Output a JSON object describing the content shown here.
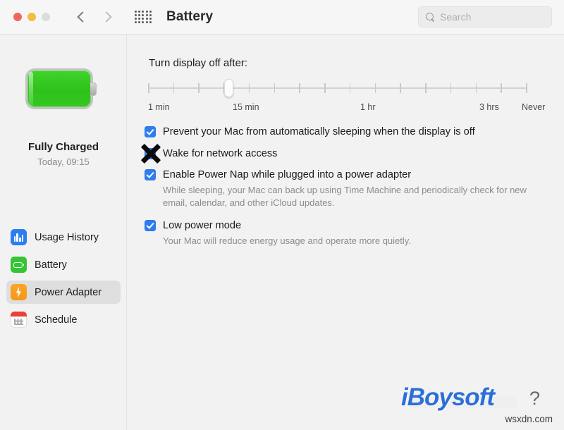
{
  "window": {
    "title": "Battery",
    "traffic_lights": [
      "close",
      "minimize",
      "zoom"
    ],
    "nav_back_icon": "chevron-left-icon",
    "nav_forward_icon": "chevron-right-icon",
    "grid_icon": "all-preferences-grid-icon"
  },
  "search": {
    "placeholder": "Search",
    "value": "",
    "icon": "search-icon"
  },
  "sidebar": {
    "battery_icon": "battery-full-green-icon",
    "status": "Fully Charged",
    "substatus": "Today, 09:15",
    "items": [
      {
        "label": "Usage History",
        "icon": "bar-chart-icon",
        "selected": false
      },
      {
        "label": "Battery",
        "icon": "battery-icon",
        "selected": false
      },
      {
        "label": "Power Adapter",
        "icon": "power-bolt-icon",
        "selected": true
      },
      {
        "label": "Schedule",
        "icon": "calendar-icon",
        "selected": false
      }
    ]
  },
  "main": {
    "slider": {
      "label": "Turn display off after:",
      "tick_count": 16,
      "thumb_position_index": 3,
      "scale_labels": [
        "1 min",
        "15 min",
        "1 hr",
        "3 hrs",
        "Never"
      ]
    },
    "options": [
      {
        "label": "Prevent your Mac from automatically sleeping when the display is off",
        "checked": true,
        "desc": ""
      },
      {
        "label": "Wake for network access",
        "checked": true,
        "desc": "",
        "annotation": "black-x-mark"
      },
      {
        "label": "Enable Power Nap while plugged into a power adapter",
        "checked": true,
        "desc": "While sleeping, your Mac can back up using Time Machine and periodically check for new email, calendar, and other iCloud updates."
      },
      {
        "label": "Low power mode",
        "checked": true,
        "desc": "Your Mac will reduce energy usage and operate more quietly."
      }
    ]
  },
  "watermark": {
    "logo": "iBoysoft",
    "question_mark": "?",
    "subtitle": "wsxdn.com"
  },
  "colors": {
    "accent_blue": "#2c7ef0",
    "battery_green": "#35c434",
    "power_orange": "#f6961a",
    "schedule_red": "#e8413a",
    "watermark_blue": "#2b6fd8"
  }
}
